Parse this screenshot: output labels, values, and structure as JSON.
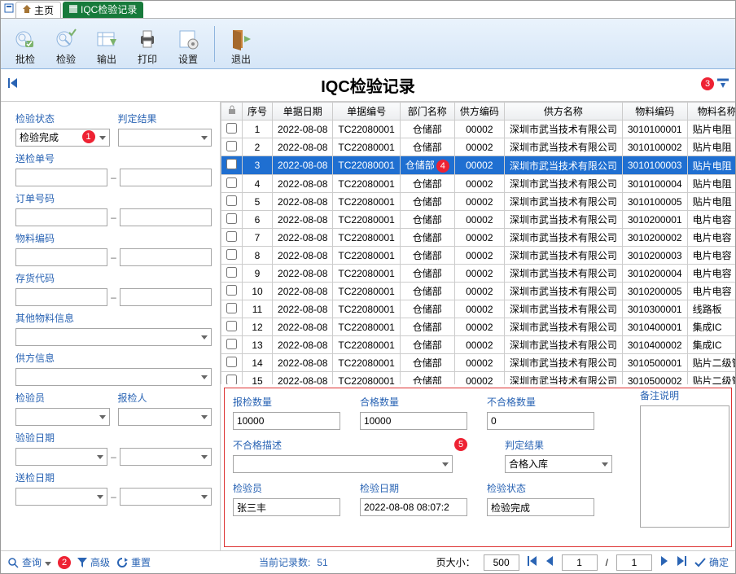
{
  "tabs": {
    "home": "主页",
    "active": "IQC检验记录"
  },
  "toolbar": [
    {
      "label": "批检",
      "icon": "batch"
    },
    {
      "label": "检验",
      "icon": "inspect"
    },
    {
      "label": "输出",
      "icon": "export"
    },
    {
      "label": "打印",
      "icon": "print"
    },
    {
      "label": "设置",
      "icon": "settings"
    },
    {
      "label": "退出",
      "icon": "exit"
    }
  ],
  "title": "IQC检验记录",
  "filters": {
    "inspect_status_label": "检验状态",
    "inspect_status_value": "检验完成",
    "verdict_label": "判定结果",
    "send_no_label": "送检单号",
    "order_no_label": "订单号码",
    "material_code_label": "物料编码",
    "inventory_code_label": "存货代码",
    "other_material_label": "其他物料信息",
    "supplier_label": "供方信息",
    "inspector_label": "检验员",
    "reporter_label": "报检人",
    "verify_date_label": "验验日期",
    "send_date_label": "送检日期"
  },
  "footer_buttons": {
    "query": "查询",
    "advanced": "高级",
    "reset": "重置",
    "confirm": "确定"
  },
  "grid": {
    "headers": [
      "",
      "序号",
      "单据日期",
      "单据编号",
      "部门名称",
      "供方编码",
      "供方名称",
      "物料编码",
      "物料名称"
    ],
    "rows": [
      {
        "n": 1,
        "d": "2022-08-08",
        "no": "TC22080001",
        "dept": "仓储部",
        "sc": "00002",
        "sn": "深圳市武当技术有限公司",
        "mc": "3010100001",
        "mn": "贴片电阻"
      },
      {
        "n": 2,
        "d": "2022-08-08",
        "no": "TC22080001",
        "dept": "仓储部",
        "sc": "00002",
        "sn": "深圳市武当技术有限公司",
        "mc": "3010100002",
        "mn": "贴片电阻"
      },
      {
        "n": 3,
        "d": "2022-08-08",
        "no": "TC22080001",
        "dept": "仓储部",
        "sc": "00002",
        "sn": "深圳市武当技术有限公司",
        "mc": "3010100003",
        "mn": "贴片电阻",
        "sel": true
      },
      {
        "n": 4,
        "d": "2022-08-08",
        "no": "TC22080001",
        "dept": "仓储部",
        "sc": "00002",
        "sn": "深圳市武当技术有限公司",
        "mc": "3010100004",
        "mn": "贴片电阻"
      },
      {
        "n": 5,
        "d": "2022-08-08",
        "no": "TC22080001",
        "dept": "仓储部",
        "sc": "00002",
        "sn": "深圳市武当技术有限公司",
        "mc": "3010100005",
        "mn": "贴片电阻"
      },
      {
        "n": 6,
        "d": "2022-08-08",
        "no": "TC22080001",
        "dept": "仓储部",
        "sc": "00002",
        "sn": "深圳市武当技术有限公司",
        "mc": "3010200001",
        "mn": "电片电容"
      },
      {
        "n": 7,
        "d": "2022-08-08",
        "no": "TC22080001",
        "dept": "仓储部",
        "sc": "00002",
        "sn": "深圳市武当技术有限公司",
        "mc": "3010200002",
        "mn": "电片电容"
      },
      {
        "n": 8,
        "d": "2022-08-08",
        "no": "TC22080001",
        "dept": "仓储部",
        "sc": "00002",
        "sn": "深圳市武当技术有限公司",
        "mc": "3010200003",
        "mn": "电片电容"
      },
      {
        "n": 9,
        "d": "2022-08-08",
        "no": "TC22080001",
        "dept": "仓储部",
        "sc": "00002",
        "sn": "深圳市武当技术有限公司",
        "mc": "3010200004",
        "mn": "电片电容"
      },
      {
        "n": 10,
        "d": "2022-08-08",
        "no": "TC22080001",
        "dept": "仓储部",
        "sc": "00002",
        "sn": "深圳市武当技术有限公司",
        "mc": "3010200005",
        "mn": "电片电容"
      },
      {
        "n": 11,
        "d": "2022-08-08",
        "no": "TC22080001",
        "dept": "仓储部",
        "sc": "00002",
        "sn": "深圳市武当技术有限公司",
        "mc": "3010300001",
        "mn": "线路板"
      },
      {
        "n": 12,
        "d": "2022-08-08",
        "no": "TC22080001",
        "dept": "仓储部",
        "sc": "00002",
        "sn": "深圳市武当技术有限公司",
        "mc": "3010400001",
        "mn": "集成IC"
      },
      {
        "n": 13,
        "d": "2022-08-08",
        "no": "TC22080001",
        "dept": "仓储部",
        "sc": "00002",
        "sn": "深圳市武当技术有限公司",
        "mc": "3010400002",
        "mn": "集成IC"
      },
      {
        "n": 14,
        "d": "2022-08-08",
        "no": "TC22080001",
        "dept": "仓储部",
        "sc": "00002",
        "sn": "深圳市武当技术有限公司",
        "mc": "3010500001",
        "mn": "贴片二级管"
      },
      {
        "n": 15,
        "d": "2022-08-08",
        "no": "TC22080001",
        "dept": "仓储部",
        "sc": "00002",
        "sn": "深圳市武当技术有限公司",
        "mc": "3010500002",
        "mn": "贴片二级管"
      }
    ]
  },
  "detail": {
    "report_qty_label": "报检数量",
    "report_qty": "10000",
    "pass_qty_label": "合格数量",
    "pass_qty": "10000",
    "fail_qty_label": "不合格数量",
    "fail_qty": "0",
    "remark_label": "备注说明",
    "remark": "",
    "fail_desc_label": "不合格描述",
    "fail_desc": "",
    "verdict_label": "判定结果",
    "verdict": "合格入库",
    "inspector_label": "检验员",
    "inspector": "张三丰",
    "inspect_date_label": "检验日期",
    "inspect_date": "2022-08-08 08:07:2",
    "status_label": "检验状态",
    "status": "检验完成"
  },
  "pager": {
    "record_count_label": "当前记录数:",
    "record_count": "51",
    "page_size_label": "页大小：",
    "page_size": "500",
    "current": "1",
    "total": "1",
    "sep": "/"
  },
  "annotations": [
    "1",
    "2",
    "3",
    "4",
    "5"
  ]
}
